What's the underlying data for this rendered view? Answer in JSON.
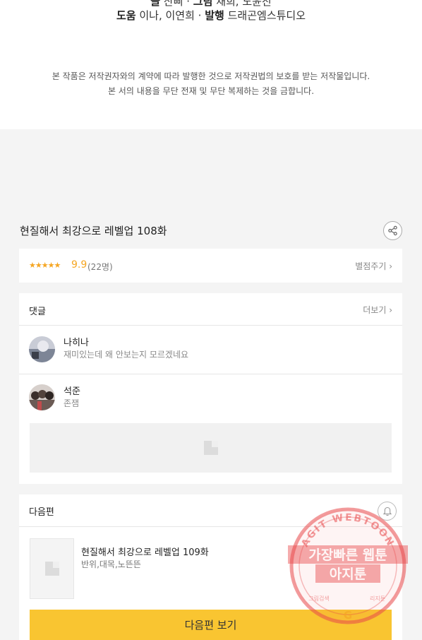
{
  "credits": {
    "cut_line": {
      "label1": "글",
      "value1": "산삐",
      "label2": "그림",
      "value2": "채희, 도윤진"
    },
    "line": {
      "label1": "도움",
      "value1": "이나, 이연희",
      "separator": "·",
      "label2": "발행",
      "value2": "드래곤엠스튜디오"
    },
    "notice_line1": "본 작품은 저작권자와의 계약에 따라 발행한 것으로 저작권법의 보호를 받는 저작물입니다.",
    "notice_line2": "본 서의 내용을 무단 전재 및 무단 복제하는 것을 금합니다."
  },
  "episode": {
    "title": "현질해서 최강으로 레벨업 108화",
    "share_icon": "share-icon"
  },
  "rating": {
    "stars": "★★★★★",
    "score": "9.9",
    "count": "(22명)",
    "rate_link": "별점주기 ›"
  },
  "comments": {
    "label": "댓글",
    "more": "더보기 ›",
    "items": [
      {
        "name": "나히나",
        "text": "재미있는데 왜 안보는지 모르겠네요"
      },
      {
        "name": "석준",
        "text": "존잼"
      }
    ]
  },
  "next_episode": {
    "label": "다음편",
    "bell_icon": "bell-icon",
    "title": "현질해서 최강으로 레벨업 109화",
    "tags": "반위,대목,노뜬뜬",
    "button": "다음편 보기"
  },
  "watermark": {
    "arc_text": "AGIT WEBTOON",
    "line1": "가장빠른 웹툰",
    "line2": "아지툰",
    "bottom_left": "그림검색",
    "bottom_right": "리지툰",
    "center_glyph": "G"
  },
  "colors": {
    "accent": "#f9c531",
    "star": "#f5a623",
    "stamp": "#e8484a"
  }
}
